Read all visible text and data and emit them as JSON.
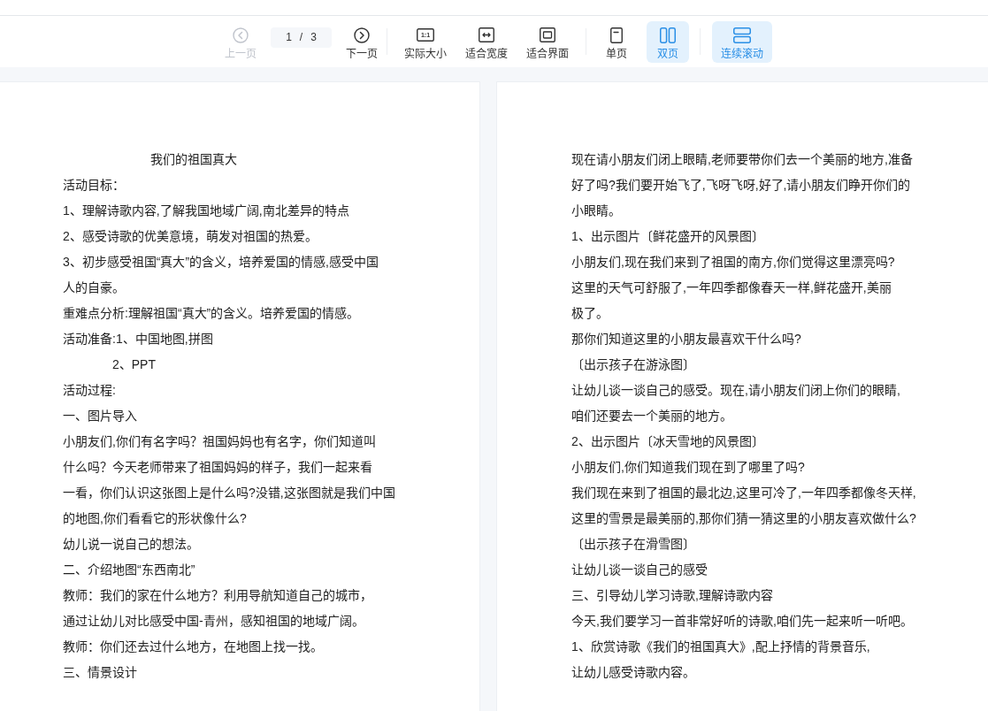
{
  "toolbar": {
    "navigation": [
      {
        "kind": "prev",
        "label": "上一页",
        "disabled": true
      },
      {
        "kind": "page-indicator",
        "current": "1",
        "separator": "/",
        "total": "3"
      },
      {
        "kind": "next",
        "label": "下一页",
        "disabled": false
      }
    ],
    "zoom": [
      {
        "kind": "actual-size",
        "label": "实际大小",
        "icon_text": "1:1"
      },
      {
        "kind": "fit-width",
        "label": "适合宽度"
      },
      {
        "kind": "fit-page",
        "label": "适合界面"
      }
    ],
    "view": [
      {
        "kind": "single",
        "label": "单页",
        "selected": false
      },
      {
        "kind": "double",
        "label": "双页",
        "selected": true
      }
    ],
    "scroll": [
      {
        "kind": "continuous",
        "label": "连续滚动",
        "on": true
      }
    ]
  },
  "pages": [
    {
      "lines": [
        {
          "kind": "title",
          "text": "我们的祖国真大"
        },
        {
          "kind": "body",
          "text": "活动目标："
        },
        {
          "kind": "body",
          "text": "1、理解诗歌内容,了解我国地域广阔,南北差异的特点"
        },
        {
          "kind": "body",
          "text": "2、感受诗歌的优美意境，萌发对祖国的热爱。"
        },
        {
          "kind": "body",
          "text": "3、初步感受祖国“真大”的含义，培养爱国的情感,感受中国"
        },
        {
          "kind": "body",
          "text": "人的自豪。"
        },
        {
          "kind": "body",
          "text": "重难点分析:理解祖国“真大”的含义。培养爱国的情感。"
        },
        {
          "kind": "body",
          "text": "活动准备:1、中国地图,拼图"
        },
        {
          "kind": "indented",
          "text": "2、PPT"
        },
        {
          "kind": "body",
          "text": "活动过程:"
        },
        {
          "kind": "body",
          "text": "一、图片导入"
        },
        {
          "kind": "body",
          "text": "小朋友们,你们有名字吗？祖国妈妈也有名字，你们知道叫"
        },
        {
          "kind": "body",
          "text": "什么吗？今天老师带来了祖国妈妈的样子，我们一起来看"
        },
        {
          "kind": "body",
          "text": "一看，你们认识这张图上是什么吗?没错,这张图就是我们中国"
        },
        {
          "kind": "body",
          "text": "的地图,你们看看它的形状像什么?"
        },
        {
          "kind": "body",
          "text": "幼儿说一说自己的想法。"
        },
        {
          "kind": "body",
          "text": "二、介绍地图“东西南北”"
        },
        {
          "kind": "body",
          "text": "教师：我们的家在什么地方？利用导航知道自己的城市，"
        },
        {
          "kind": "body",
          "text": "通过让幼儿对比感受中国-青州，感知祖国的地域广阔。"
        },
        {
          "kind": "body",
          "text": "教师：你们还去过什么地方，在地图上找一找。"
        },
        {
          "kind": "body",
          "text": "三、情景设计"
        }
      ]
    },
    {
      "lines": [
        {
          "kind": "body",
          "text": "现在请小朋友们闭上眼睛,老师要带你们去一个美丽的地方,准备"
        },
        {
          "kind": "body",
          "text": "好了吗?我们要开始飞了,飞呀飞呀,好了,请小朋友们睁开你们的"
        },
        {
          "kind": "body",
          "text": "小眼睛。"
        },
        {
          "kind": "body",
          "text": "1、出示图片〔鲜花盛开的风景图〕"
        },
        {
          "kind": "body",
          "text": "小朋友们,现在我们来到了祖国的南方,你们觉得这里漂亮吗?"
        },
        {
          "kind": "body",
          "text": "这里的天气可舒服了,一年四季都像春天一样,鲜花盛开,美丽"
        },
        {
          "kind": "body",
          "text": "极了。"
        },
        {
          "kind": "body",
          "text": "那你们知道这里的小朋友最喜欢干什么吗?"
        },
        {
          "kind": "body",
          "text": "〔出示孩子在游泳图〕"
        },
        {
          "kind": "body",
          "text": "让幼儿谈一谈自己的感受。现在,请小朋友们闭上你们的眼睛,"
        },
        {
          "kind": "body",
          "text": "咱们还要去一个美丽的地方。"
        },
        {
          "kind": "body",
          "text": "2、出示图片〔冰天雪地的风景图〕"
        },
        {
          "kind": "body",
          "text": "小朋友们,你们知道我们现在到了哪里了吗?"
        },
        {
          "kind": "body",
          "text": "我们现在来到了祖国的最北边,这里可冷了,一年四季都像冬天样,"
        },
        {
          "kind": "body",
          "text": "这里的雪景是最美丽的,那你们猜一猜这里的小朋友喜欢做什么?"
        },
        {
          "kind": "body",
          "text": "〔出示孩子在滑雪图〕"
        },
        {
          "kind": "body",
          "text": "让幼儿谈一谈自己的感受"
        },
        {
          "kind": "body",
          "text": "三、引导幼儿学习诗歌,理解诗歌内容"
        },
        {
          "kind": "body",
          "text": "今天,我们要学习一首非常好听的诗歌,咱们先一起来听一听吧。"
        },
        {
          "kind": "body",
          "text": "1、欣赏诗歌《我们的祖国真大》,配上抒情的背景音乐,"
        },
        {
          "kind": "body",
          "text": "让幼儿感受诗歌内容。"
        }
      ]
    }
  ]
}
